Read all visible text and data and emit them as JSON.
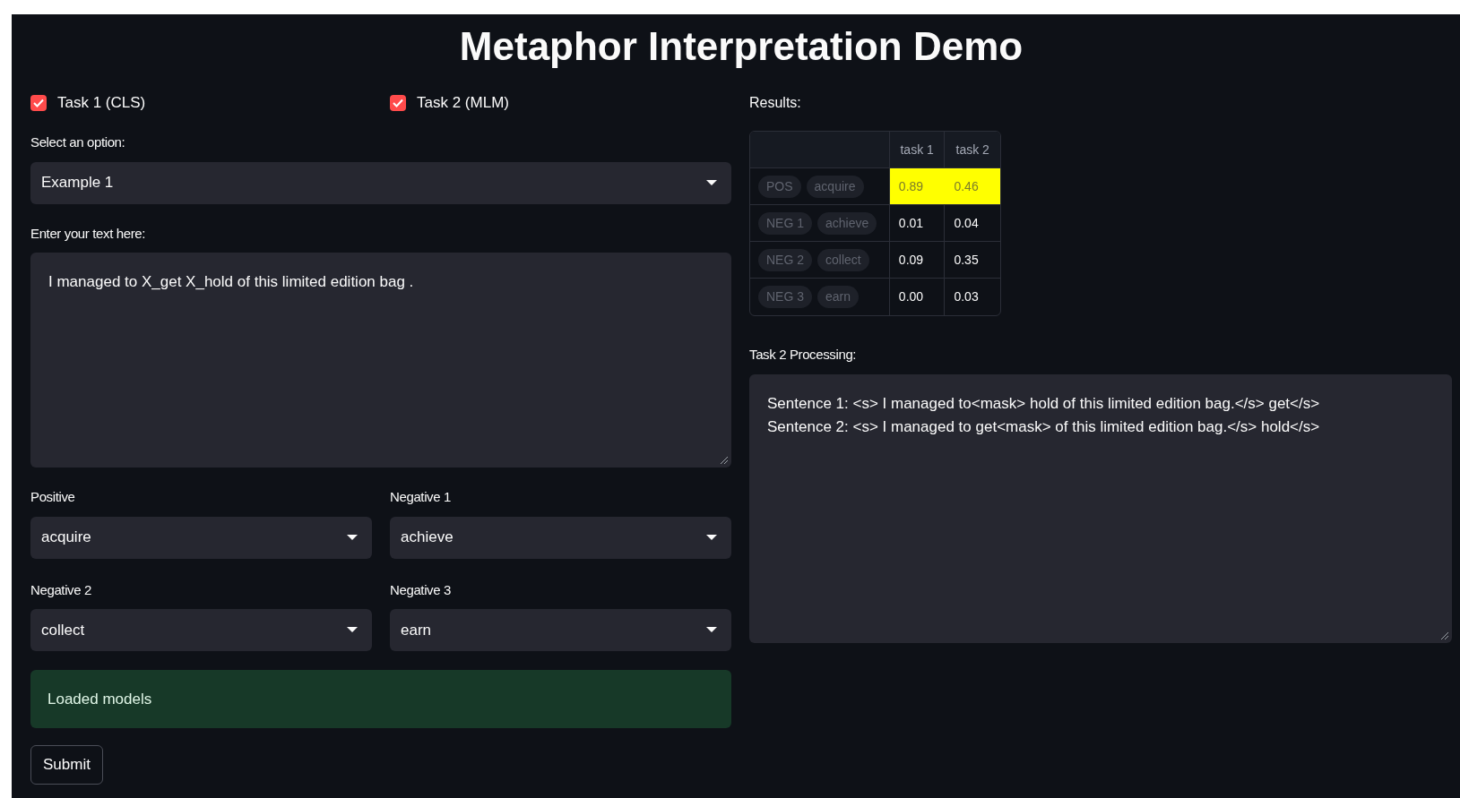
{
  "title": "Metaphor Interpretation Demo",
  "tasks": [
    {
      "label": "Task 1 (CLS)",
      "checked": true
    },
    {
      "label": "Task 2 (MLM)",
      "checked": true
    }
  ],
  "option_select": {
    "label": "Select an option:",
    "value": "Example 1"
  },
  "text_input": {
    "label": "Enter your text here:",
    "value": "I managed to X_get X_hold of this limited edition bag ."
  },
  "candidates": [
    {
      "label": "Positive",
      "value": "acquire"
    },
    {
      "label": "Negative 1",
      "value": "achieve"
    },
    {
      "label": "Negative 2",
      "value": "collect"
    },
    {
      "label": "Negative 3",
      "value": "earn"
    }
  ],
  "status": {
    "message": "Loaded models"
  },
  "submit_button": "Submit",
  "results": {
    "label": "Results:",
    "columns": [
      "task 1",
      "task 2"
    ],
    "rows": [
      {
        "tags": [
          "POS",
          "acquire"
        ],
        "values": [
          "0.89",
          "0.46"
        ],
        "highlighted": true
      },
      {
        "tags": [
          "NEG 1",
          "achieve"
        ],
        "values": [
          "0.01",
          "0.04"
        ],
        "highlighted": false
      },
      {
        "tags": [
          "NEG 2",
          "collect"
        ],
        "values": [
          "0.09",
          "0.35"
        ],
        "highlighted": false
      },
      {
        "tags": [
          "NEG 3",
          "earn"
        ],
        "values": [
          "0.00",
          "0.03"
        ],
        "highlighted": false
      }
    ]
  },
  "processing": {
    "label": "Task 2 Processing:",
    "lines": [
      "Sentence 1: <s> I managed to<mask> hold of this limited edition bag.</s> get</s>",
      "Sentence 2: <s> I managed to get<mask> of this limited edition bag.</s> hold</s>"
    ]
  }
}
